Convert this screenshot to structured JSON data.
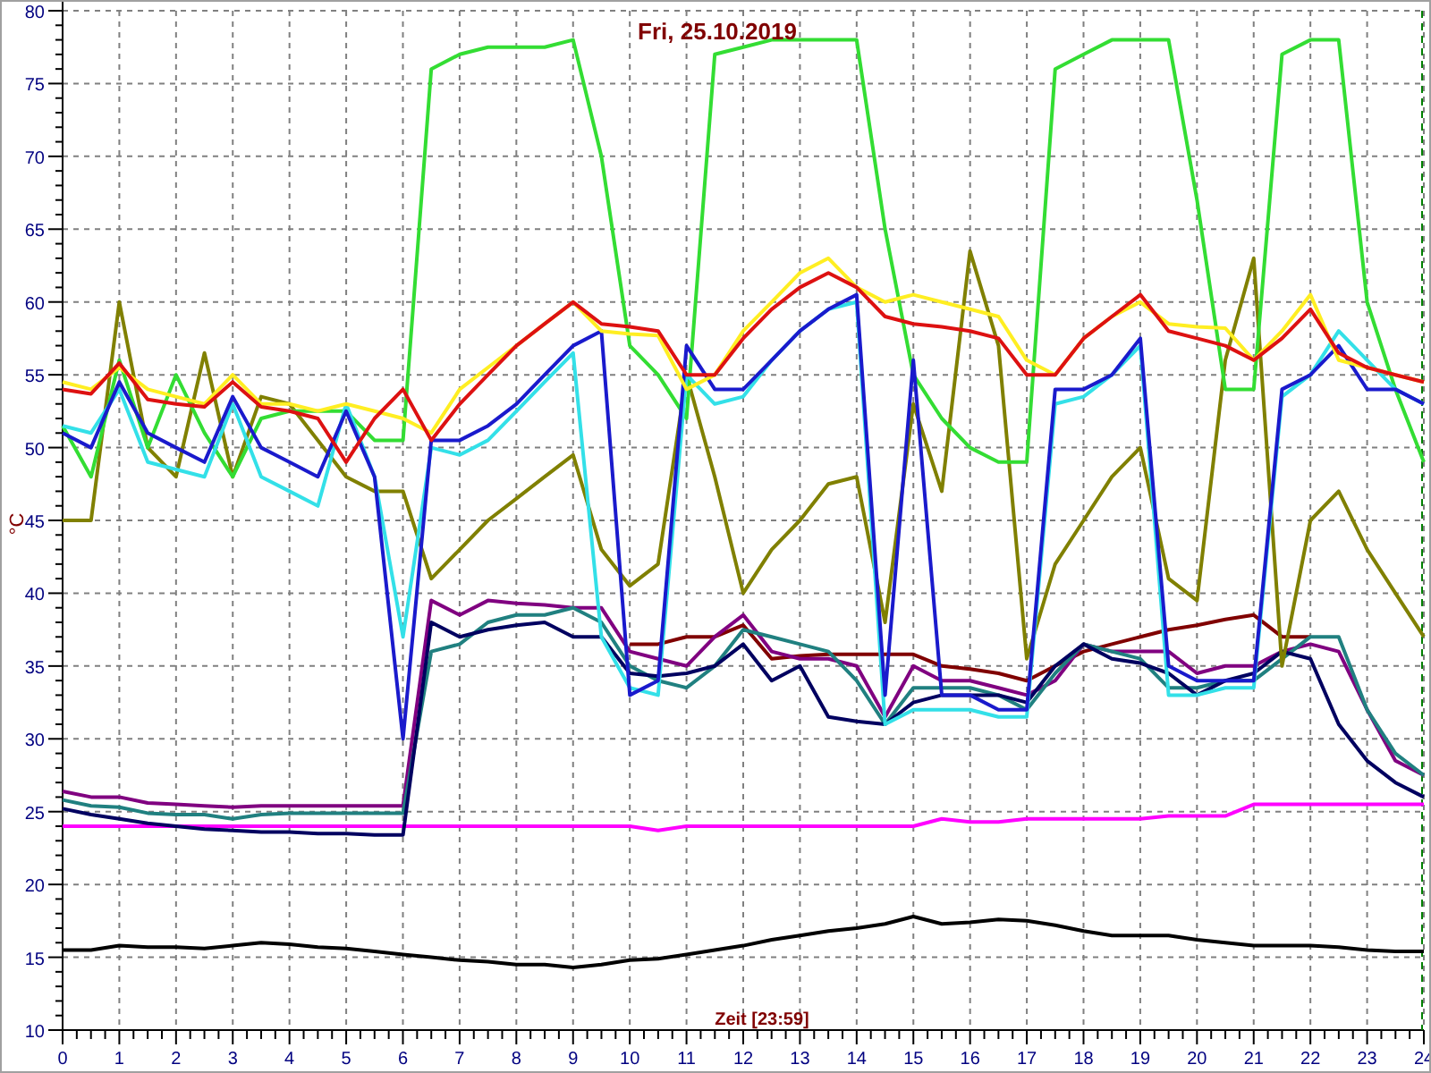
{
  "chart": {
    "chart_data": {
      "type": "line",
      "title": "Fri, 25.10.2019",
      "xlabel": "Zeit [23:59]",
      "ylabel": "°C",
      "grid": true,
      "xlim": [
        0,
        24
      ],
      "ylim": [
        10,
        80
      ],
      "xticks": [
        0,
        1,
        2,
        3,
        4,
        5,
        6,
        7,
        8,
        9,
        10,
        11,
        12,
        13,
        14,
        15,
        16,
        17,
        18,
        19,
        20,
        21,
        22,
        23,
        24
      ],
      "yticks": [
        10,
        15,
        20,
        25,
        30,
        35,
        40,
        45,
        50,
        55,
        60,
        65,
        70,
        75,
        80
      ],
      "x": [
        0,
        0.5,
        1,
        1.5,
        2,
        2.5,
        3,
        3.5,
        4,
        4.5,
        5,
        5.5,
        6,
        6.5,
        7,
        7.5,
        8,
        8.5,
        9,
        9.5,
        10,
        10.5,
        11,
        11.5,
        12,
        12.5,
        13,
        13.5,
        14,
        14.5,
        15,
        15.5,
        16,
        16.5,
        17,
        17.5,
        18,
        18.5,
        19,
        19.5,
        20,
        20.5,
        21,
        21.5,
        22,
        22.5,
        23,
        23.5,
        24
      ],
      "series": [
        {
          "color": "#000000",
          "values": [
            15.5,
            15.5,
            15.8,
            15.7,
            15.7,
            15.6,
            15.8,
            16,
            15.9,
            15.7,
            15.6,
            15.4,
            15.2,
            15,
            14.8,
            14.7,
            14.5,
            14.5,
            14.3,
            14.5,
            14.8,
            14.9,
            15.2,
            15.5,
            15.8,
            16.2,
            16.5,
            16.8,
            17,
            17.3,
            17.8,
            17.3,
            17.4,
            17.6,
            17.5,
            17.2,
            16.8,
            16.5,
            16.5,
            16.5,
            16.2,
            16,
            15.8,
            15.8,
            15.8,
            15.7,
            15.5,
            15.4,
            15.4
          ]
        },
        {
          "color": "#ff00ff",
          "values": [
            24,
            24,
            24,
            24,
            24,
            24,
            24,
            24,
            24,
            24,
            24,
            24,
            24,
            24,
            24,
            24,
            24,
            24,
            24,
            24,
            24,
            23.7,
            24,
            24,
            24,
            24,
            24,
            24,
            24,
            24,
            24,
            24.5,
            24.3,
            24.3,
            24.5,
            24.5,
            24.5,
            24.5,
            24.5,
            24.7,
            24.7,
            24.7,
            25.5,
            25.5,
            25.5,
            25.5,
            25.5,
            25.5,
            25.5
          ]
        },
        {
          "color": "#800000",
          "values": [
            null,
            null,
            null,
            null,
            null,
            null,
            null,
            null,
            null,
            null,
            null,
            null,
            null,
            null,
            null,
            null,
            null,
            null,
            null,
            null,
            36.5,
            36.5,
            37,
            37,
            37.8,
            35.5,
            35.7,
            35.8,
            35.8,
            35.8,
            35.8,
            35,
            34.8,
            34.5,
            34,
            35,
            36,
            36.5,
            37,
            37.5,
            37.8,
            38.2,
            38.5,
            37,
            37,
            null,
            null,
            null,
            null
          ]
        },
        {
          "color": "#800080",
          "values": [
            26.4,
            26,
            26,
            25.6,
            25.5,
            25.4,
            25.3,
            25.4,
            25.4,
            25.4,
            25.4,
            25.4,
            25.4,
            39.5,
            38.5,
            39.5,
            39.3,
            39.2,
            39,
            39,
            36,
            35.5,
            35,
            37,
            38.5,
            36,
            35.5,
            35.5,
            35,
            31.5,
            35,
            34,
            34,
            33.5,
            33,
            34,
            36.5,
            36,
            36,
            36,
            34.5,
            35,
            35,
            36,
            36.5,
            36,
            32,
            28.5,
            27.5
          ]
        },
        {
          "color": "#208080",
          "values": [
            25.8,
            25.4,
            25.3,
            24.9,
            24.8,
            24.8,
            24.5,
            24.8,
            24.9,
            24.9,
            24.9,
            24.9,
            24.9,
            36,
            36.5,
            38,
            38.5,
            38.5,
            39,
            38,
            35,
            34,
            33.5,
            35,
            37.5,
            37,
            36.5,
            36,
            34,
            31,
            33.5,
            33.5,
            33.5,
            33,
            32,
            34.5,
            36.5,
            36,
            35.5,
            33.5,
            33.5,
            34,
            34,
            35.5,
            37,
            37,
            32,
            29,
            27.5
          ]
        },
        {
          "color": "#000060",
          "values": [
            25.2,
            24.8,
            24.5,
            24.2,
            24,
            23.8,
            23.7,
            23.6,
            23.6,
            23.5,
            23.5,
            23.4,
            23.4,
            38,
            37,
            37.5,
            37.8,
            38,
            37,
            37,
            34.5,
            34.3,
            34.5,
            35,
            36.5,
            34,
            35,
            31.5,
            31.2,
            31,
            32.5,
            33,
            33,
            33,
            32.5,
            35,
            36.5,
            35.5,
            35.2,
            34.5,
            33,
            34,
            34.5,
            36,
            35.5,
            31,
            28.5,
            27,
            26
          ]
        },
        {
          "color": "#808000",
          "values": [
            45,
            45,
            60,
            50,
            48,
            56.5,
            48,
            53.5,
            53,
            50.5,
            48,
            47,
            47,
            41,
            43,
            45,
            46.5,
            48,
            49.5,
            43,
            40.5,
            42,
            55,
            48,
            40,
            43,
            45,
            47.5,
            48,
            38,
            53,
            47,
            63.5,
            57,
            35.5,
            42,
            45,
            48,
            50,
            41,
            39.5,
            56,
            63,
            35,
            45,
            47,
            43,
            40,
            37
          ]
        },
        {
          "color": "#33dd33",
          "values": [
            51.5,
            48,
            56,
            50,
            55,
            51,
            48,
            52,
            52.5,
            52.5,
            52.5,
            50.5,
            50.5,
            76,
            77,
            77.5,
            77.5,
            77.5,
            78,
            70,
            57,
            55,
            52,
            77,
            77.5,
            78,
            78,
            78,
            78,
            65,
            55,
            52,
            50,
            49,
            49,
            76,
            77,
            78,
            78,
            78,
            67,
            54,
            54,
            77,
            78,
            78,
            60,
            54,
            49
          ]
        },
        {
          "color": "#33e0e8",
          "values": [
            51.5,
            51,
            54,
            49,
            48.5,
            48,
            53,
            48,
            47,
            46,
            53,
            48,
            37,
            50,
            49.5,
            50.5,
            52.5,
            54.5,
            56.5,
            37,
            33.5,
            33,
            55,
            53,
            53.5,
            56,
            58,
            59.5,
            60,
            31,
            32,
            32,
            32,
            31.5,
            31.5,
            53,
            53.5,
            55,
            57,
            33,
            33,
            33.5,
            33.5,
            53.5,
            55,
            58,
            56,
            54,
            53
          ]
        },
        {
          "color": "#1a1acc",
          "values": [
            51,
            50,
            54.5,
            51,
            50,
            49,
            53.5,
            50,
            49,
            48,
            52.5,
            48,
            30,
            50.5,
            50.5,
            51.5,
            53,
            55,
            57,
            58,
            33,
            34,
            57,
            54,
            54,
            56,
            58,
            59.5,
            60.5,
            33,
            56,
            33,
            33,
            32,
            32,
            54,
            54,
            55,
            57.5,
            35,
            34,
            34,
            34,
            54,
            55,
            57,
            54,
            54,
            53
          ]
        },
        {
          "color": "#ffee22",
          "values": [
            54.5,
            54,
            55.5,
            54,
            53.5,
            53,
            55,
            53,
            53,
            52.5,
            53,
            52.5,
            52,
            51,
            54,
            55.5,
            57,
            58.5,
            60,
            58,
            57.8,
            57.7,
            54,
            55,
            58,
            60,
            62,
            63,
            61,
            60,
            60.5,
            60,
            59.5,
            59,
            56,
            55,
            57.5,
            59,
            60,
            58.5,
            58.3,
            58.2,
            56,
            58,
            60.5,
            56,
            55.5,
            55,
            54.5
          ]
        },
        {
          "color": "#dd1111",
          "values": [
            54,
            53.7,
            55.8,
            53.3,
            53,
            52.8,
            54.5,
            52.8,
            52.5,
            52,
            49,
            52,
            54,
            50.5,
            53,
            55,
            57,
            58.5,
            60,
            58.5,
            58.3,
            58,
            55,
            55,
            57.5,
            59.5,
            61,
            62,
            61,
            59,
            58.5,
            58.3,
            58,
            57.5,
            55,
            55,
            57.5,
            59,
            60.5,
            58,
            57.5,
            57,
            56,
            57.5,
            59.5,
            56.5,
            55.5,
            55,
            54.5
          ]
        }
      ]
    }
  }
}
